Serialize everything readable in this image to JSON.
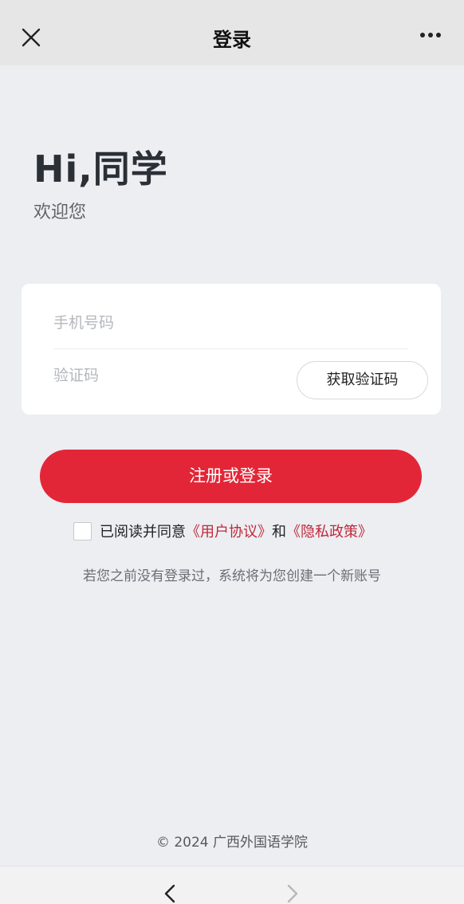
{
  "header": {
    "title": "登录",
    "close_icon": "close-icon",
    "more_icon": "more-icon"
  },
  "greeting": {
    "title": "Hi,同学",
    "subtitle": "欢迎您"
  },
  "form": {
    "phone_placeholder": "手机号码",
    "code_placeholder": "验证码",
    "get_code_label": "获取验证码"
  },
  "submit_label": "注册或登录",
  "agreement": {
    "checked": false,
    "prefix": "已阅读并同意",
    "user_agreement": "《用户协议》",
    "and": "和",
    "privacy_policy": "《隐私政策》"
  },
  "note": "若您之前没有登录过，系统将为您创建一个新账号",
  "footer": "© 2024 广西外国语学院",
  "colors": {
    "accent": "#e32637",
    "link": "#c0283a",
    "background": "#eceef2"
  }
}
